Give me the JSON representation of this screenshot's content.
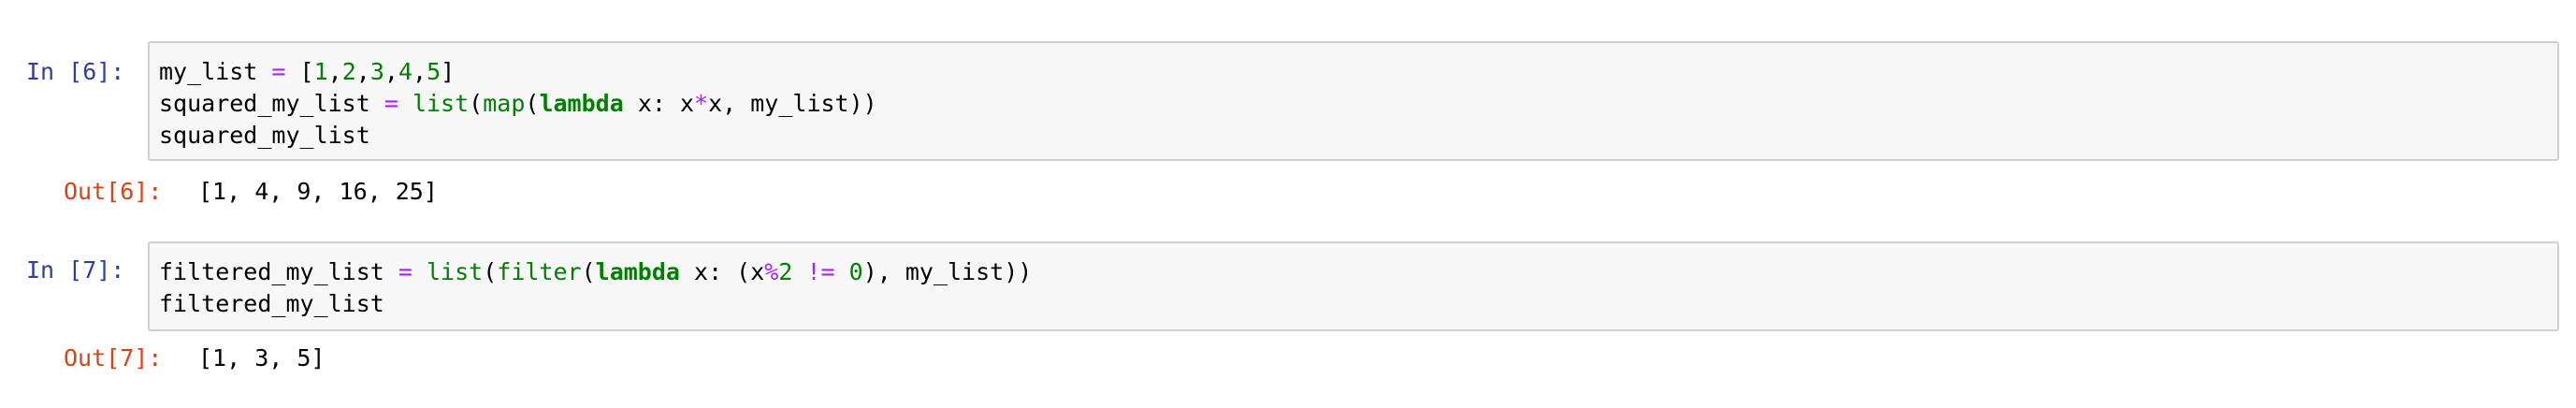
{
  "colors": {
    "in_prompt": "#303f9f",
    "out_prompt": "#d84315",
    "keyword": "#008000",
    "number": "#008000",
    "operator": "#aa22ff",
    "cell_background": "#f7f7f7",
    "cell_border": "#cfcfcf"
  },
  "cells": [
    {
      "in_prompt": "In [6]:",
      "code_lines": [
        [
          {
            "t": "my_list ",
            "k": "plain"
          },
          {
            "t": "=",
            "k": "op"
          },
          {
            "t": " [",
            "k": "plain"
          },
          {
            "t": "1",
            "k": "num"
          },
          {
            "t": ",",
            "k": "plain"
          },
          {
            "t": "2",
            "k": "num"
          },
          {
            "t": ",",
            "k": "plain"
          },
          {
            "t": "3",
            "k": "num"
          },
          {
            "t": ",",
            "k": "plain"
          },
          {
            "t": "4",
            "k": "num"
          },
          {
            "t": ",",
            "k": "plain"
          },
          {
            "t": "5",
            "k": "num"
          },
          {
            "t": "]",
            "k": "plain"
          }
        ],
        [
          {
            "t": "squared_my_list ",
            "k": "plain"
          },
          {
            "t": "=",
            "k": "op"
          },
          {
            "t": " ",
            "k": "plain"
          },
          {
            "t": "list",
            "k": "bi"
          },
          {
            "t": "(",
            "k": "plain"
          },
          {
            "t": "map",
            "k": "bi"
          },
          {
            "t": "(",
            "k": "plain"
          },
          {
            "t": "lambda",
            "k": "kw"
          },
          {
            "t": " x: x",
            "k": "plain"
          },
          {
            "t": "*",
            "k": "op"
          },
          {
            "t": "x, my_list))",
            "k": "plain"
          }
        ],
        [
          {
            "t": "squared_my_list",
            "k": "plain"
          }
        ]
      ],
      "out_prompt": "Out[6]:",
      "output": "[1, 4, 9, 16, 25]"
    },
    {
      "in_prompt": "In [7]:",
      "code_lines": [
        [
          {
            "t": "filtered_my_list ",
            "k": "plain"
          },
          {
            "t": "=",
            "k": "op"
          },
          {
            "t": " ",
            "k": "plain"
          },
          {
            "t": "list",
            "k": "bi"
          },
          {
            "t": "(",
            "k": "plain"
          },
          {
            "t": "filter",
            "k": "bi"
          },
          {
            "t": "(",
            "k": "plain"
          },
          {
            "t": "lambda",
            "k": "kw"
          },
          {
            "t": " x: (x",
            "k": "plain"
          },
          {
            "t": "%",
            "k": "op"
          },
          {
            "t": "2",
            "k": "num"
          },
          {
            "t": " ",
            "k": "plain"
          },
          {
            "t": "!=",
            "k": "op"
          },
          {
            "t": " ",
            "k": "plain"
          },
          {
            "t": "0",
            "k": "num"
          },
          {
            "t": "), my_list))",
            "k": "plain"
          }
        ],
        [
          {
            "t": "filtered_my_list",
            "k": "plain"
          }
        ]
      ],
      "out_prompt": "Out[7]:",
      "output": "[1, 3, 5]"
    }
  ]
}
